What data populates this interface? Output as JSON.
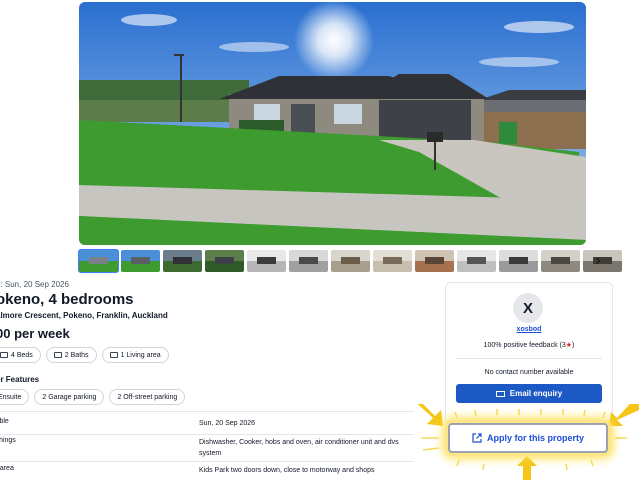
{
  "listing": {
    "listed": "d: Sun, 20 Sep 2026",
    "title": "okeno, 4 bedrooms",
    "address": "almore Crescent, Pokeno, Franklin, Auckland",
    "price": "00 per week",
    "chips": [
      "4 Beds",
      "2 Baths",
      "1 Living area"
    ],
    "features_title": "er Features",
    "features": [
      "Ensuite",
      "2 Garage parking",
      "2 Off-street parking"
    ],
    "rows": [
      {
        "key": "lable",
        "value": "Sun, 20 Sep 2026"
      },
      {
        "key": "ishings",
        "value": "Dishwasher, Cooker, hobs and oven, air conditioner unit and dvs system"
      },
      {
        "key": "e area",
        "value": "Kids Park two doors down, close to motorway and shops"
      }
    ]
  },
  "gallery": {
    "thumbnail_count": 13,
    "next_glyph": "›"
  },
  "seller": {
    "avatar_letter": "X",
    "name": "xosbod",
    "feedback": "100% positive feedback (3",
    "feedback_star": "★",
    "feedback_close": ")",
    "contact": "No contact number available",
    "enquiry_label": "Email enquiry"
  },
  "apply": {
    "label": "Apply for this property"
  },
  "colors": {
    "primary": "#1d59c4",
    "link": "#1d4ed8",
    "highlight": "#fde047",
    "arrow": "#f5c518"
  }
}
